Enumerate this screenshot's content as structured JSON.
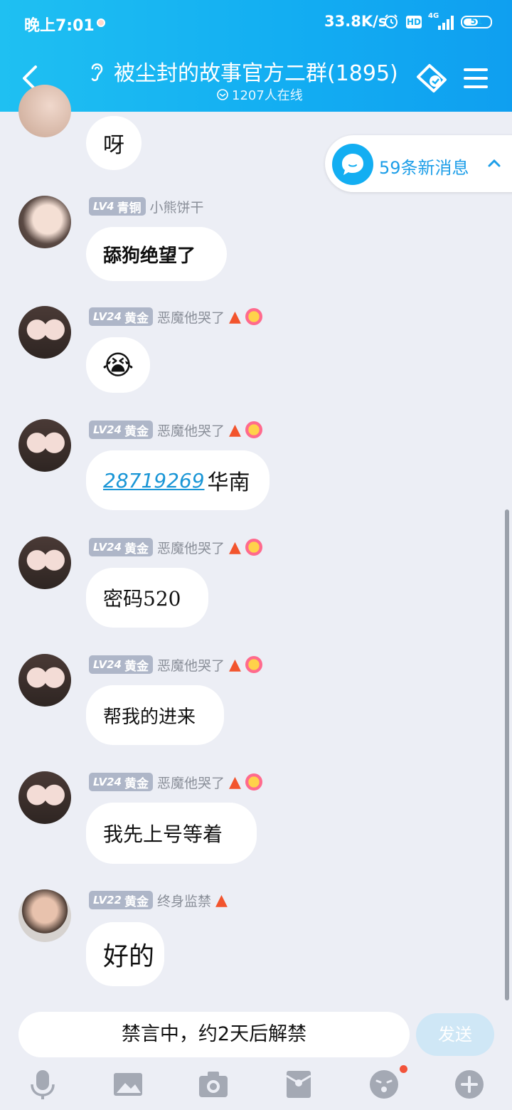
{
  "status_bar": {
    "time": "晚上7:01",
    "speed": "33.8K/s",
    "hd": "HD",
    "network": "4G",
    "battery": "51"
  },
  "header": {
    "title": "被尘封的故事官方二群(1895)",
    "online": "1207人在线"
  },
  "new_messages": {
    "label": "59条新消息"
  },
  "messages": [
    {
      "text": "呀"
    },
    {
      "level": "LV4",
      "rank": "青铜",
      "nick": "小熊饼干",
      "text": "舔狗绝望了"
    },
    {
      "level": "LV24",
      "rank": "黄金",
      "nick": "恶魔他哭了",
      "emoji": "😭"
    },
    {
      "level": "LV24",
      "rank": "黄金",
      "nick": "恶魔他哭了",
      "link": "28719269",
      "text": "华南"
    },
    {
      "level": "LV24",
      "rank": "黄金",
      "nick": "恶魔他哭了",
      "text": "密码520"
    },
    {
      "level": "LV24",
      "rank": "黄金",
      "nick": "恶魔他哭了",
      "text": "帮我的进来"
    },
    {
      "level": "LV24",
      "rank": "黄金",
      "nick": "恶魔他哭了",
      "text": "我先上号等着"
    },
    {
      "level": "LV22",
      "rank": "黄金",
      "nick": "终身监禁",
      "text": "好的"
    }
  ],
  "input": {
    "mute_text": "禁言中，约2天后解禁",
    "send_label": "发送"
  },
  "toolbar": [
    "mic-icon",
    "image-icon",
    "camera-icon",
    "red-packet-icon",
    "emoji-icon",
    "plus-icon"
  ],
  "colors": {
    "header": "#13aef2",
    "badge": "#aeb6c8",
    "link": "#1a96d6",
    "background": "#eceef5"
  }
}
